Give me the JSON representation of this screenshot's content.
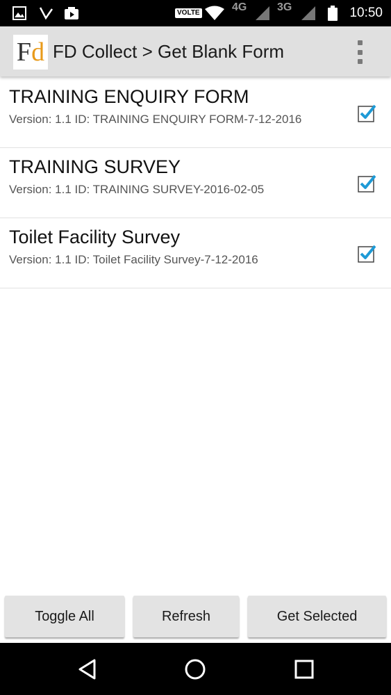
{
  "status_bar": {
    "volte": "VOLTE",
    "net_4g": "4G",
    "net_3g": "3G",
    "time": "10:50"
  },
  "action_bar": {
    "logo_f": "F",
    "logo_d": "d",
    "title": "FD Collect > Get Blank Form"
  },
  "forms": [
    {
      "title": "TRAINING ENQUIRY FORM",
      "subtitle": "Version: 1.1 ID: TRAINING ENQUIRY FORM-7-12-2016",
      "checked": true
    },
    {
      "title": "TRAINING SURVEY",
      "subtitle": "Version: 1.1 ID: TRAINING SURVEY-2016-02-05",
      "checked": true
    },
    {
      "title": "Toilet Facility Survey",
      "subtitle": "Version: 1.1 ID: Toilet Facility Survey-7-12-2016",
      "checked": true
    }
  ],
  "buttons": {
    "toggle_all": "Toggle All",
    "refresh": "Refresh",
    "get_selected": "Get Selected"
  },
  "colors": {
    "checkbox_tick": "#1e9ad6",
    "logo_accent": "#e89a1a",
    "action_bar_bg": "#e0e0e0"
  },
  "icons": {
    "status_left": [
      "image-icon",
      "missed-call-icon",
      "media-icon"
    ],
    "status_right": [
      "wifi-icon",
      "signal-icon",
      "signal-icon",
      "battery-icon"
    ],
    "nav": [
      "back-icon",
      "home-icon",
      "recents-icon"
    ]
  }
}
